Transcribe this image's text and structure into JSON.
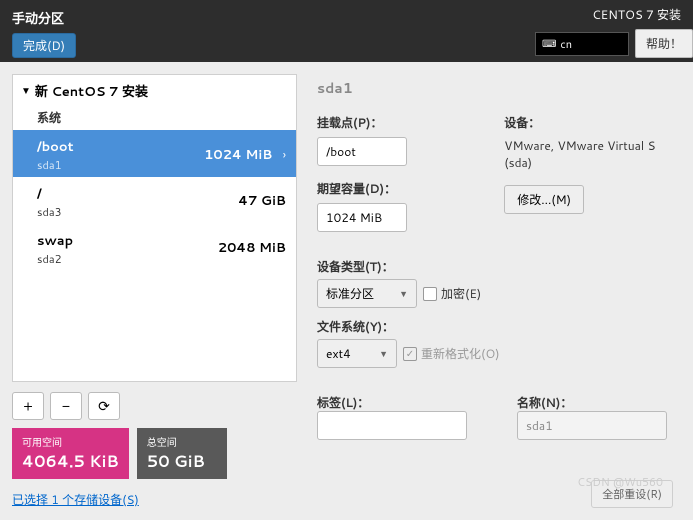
{
  "header": {
    "title": "手动分区",
    "done": "完成(D)",
    "install_title": "CENTOS 7 安装",
    "lang": "cn",
    "help": "帮助！"
  },
  "tree": {
    "root": "新 CentOS 7 安装",
    "system": "系统",
    "partitions": [
      {
        "mount": "/boot",
        "device": "sda1",
        "size": "1024 MiB",
        "selected": true
      },
      {
        "mount": "/",
        "device": "sda3",
        "size": "47 GiB",
        "selected": false
      },
      {
        "mount": "swap",
        "device": "sda2",
        "size": "2048 MiB",
        "selected": false
      }
    ]
  },
  "buttons": {
    "add": "+",
    "remove": "−",
    "reload": "⟳"
  },
  "space": {
    "avail_label": "可用空间",
    "avail_value": "4064.5 KiB",
    "total_label": "总空间",
    "total_value": "50 GiB"
  },
  "storage_link": "已选择 1 个存储设备(S)",
  "right": {
    "title": "sda1",
    "mount_label": "挂载点(P)：",
    "mount_value": "/boot",
    "capacity_label": "期望容量(D)：",
    "capacity_value": "1024 MiB",
    "device_label": "设备：",
    "device_text": "VMware, VMware Virtual S (sda)",
    "modify": "修改...(M)",
    "devtype_label": "设备类型(T)：",
    "devtype_value": "标准分区",
    "encrypt": "加密(E)",
    "fs_label": "文件系统(Y)：",
    "fs_value": "ext4",
    "reformat": "重新格式化(O)",
    "label_label": "标签(L)：",
    "label_value": "",
    "name_label": "名称(N)：",
    "name_value": "sda1",
    "reset": "全部重设(R)"
  },
  "watermark": "CSDN @Wu560"
}
